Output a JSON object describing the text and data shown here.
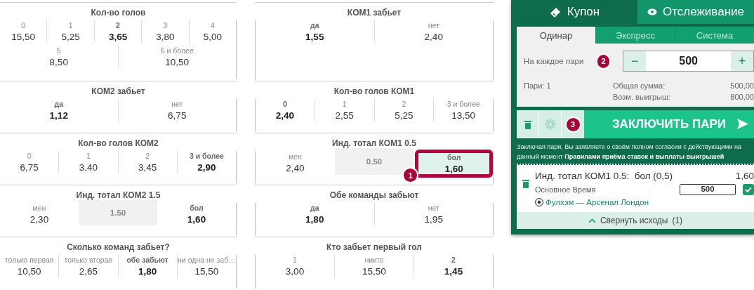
{
  "columns": [
    {
      "markets": [
        {
          "title": "Кол-во голов",
          "lines": [
            {
              "outcomes": [
                {
                  "kind": "odd",
                  "label": "0",
                  "odd": "15,50",
                  "bold": false,
                  "selected": false
                },
                {
                  "kind": "odd",
                  "label": "1",
                  "odd": "5,25",
                  "bold": false,
                  "selected": false
                },
                {
                  "kind": "odd",
                  "label": "2",
                  "odd": "3,65",
                  "bold": true,
                  "selected": false
                },
                {
                  "kind": "odd",
                  "label": "3",
                  "odd": "3,80",
                  "bold": false,
                  "selected": false
                },
                {
                  "kind": "odd",
                  "label": "4",
                  "odd": "5,00",
                  "bold": false,
                  "selected": false
                }
              ]
            },
            {
              "outcomes": [
                {
                  "kind": "odd",
                  "label": "5",
                  "odd": "8,50",
                  "bold": false,
                  "selected": false
                },
                {
                  "kind": "odd",
                  "label": "6 и более",
                  "odd": "10,50",
                  "bold": false,
                  "selected": false
                }
              ]
            }
          ]
        },
        {
          "title": "КОМ2 забьет",
          "lines": [
            {
              "outcomes": [
                {
                  "kind": "odd",
                  "label": "да",
                  "odd": "1,12",
                  "bold": true,
                  "selected": false
                },
                {
                  "kind": "odd",
                  "label": "нет",
                  "odd": "6,75",
                  "bold": false,
                  "selected": false
                }
              ]
            }
          ]
        },
        {
          "title": "Кол-во голов КОМ2",
          "lines": [
            {
              "outcomes": [
                {
                  "kind": "odd",
                  "label": "0",
                  "odd": "6,75",
                  "bold": false,
                  "selected": false
                },
                {
                  "kind": "odd",
                  "label": "1",
                  "odd": "3,40",
                  "bold": false,
                  "selected": false
                },
                {
                  "kind": "odd",
                  "label": "2",
                  "odd": "3,45",
                  "bold": false,
                  "selected": false
                },
                {
                  "kind": "odd",
                  "label": "3 и более",
                  "odd": "2,90",
                  "bold": true,
                  "selected": false
                }
              ]
            }
          ]
        },
        {
          "title": "Инд. тотал КОМ2 1.5",
          "lines": [
            {
              "outcomes": [
                {
                  "kind": "odd",
                  "label": "мен",
                  "odd": "2,30",
                  "bold": false,
                  "selected": false
                },
                {
                  "kind": "line",
                  "value": "1.50"
                },
                {
                  "kind": "odd",
                  "label": "бол",
                  "odd": "1,60",
                  "bold": true,
                  "selected": false
                }
              ]
            }
          ]
        },
        {
          "title": "Сколько команд забьет?",
          "lines": [
            {
              "outcomes": [
                {
                  "kind": "odd",
                  "label": "только первая",
                  "odd": "10,50",
                  "bold": false,
                  "selected": false
                },
                {
                  "kind": "odd",
                  "label": "только вторая",
                  "odd": "2,65",
                  "bold": false,
                  "selected": false
                },
                {
                  "kind": "odd",
                  "label": "обе забьют",
                  "odd": "1,80",
                  "bold": true,
                  "selected": false
                },
                {
                  "kind": "odd",
                  "label": "ни одна не заб…",
                  "odd": "15,50",
                  "bold": false,
                  "selected": false
                }
              ]
            }
          ]
        }
      ]
    },
    {
      "markets": [
        {
          "title": "КОМ1 забьет",
          "lines": [
            {
              "outcomes": [
                {
                  "kind": "odd",
                  "label": "да",
                  "odd": "1,55",
                  "bold": true,
                  "selected": false
                },
                {
                  "kind": "odd",
                  "label": "нет",
                  "odd": "2,40",
                  "bold": false,
                  "selected": false
                }
              ]
            }
          ]
        },
        {
          "title": "Кол-во голов КОМ1",
          "lines": [
            {
              "outcomes": [
                {
                  "kind": "odd",
                  "label": "0",
                  "odd": "2,40",
                  "bold": true,
                  "selected": false
                },
                {
                  "kind": "odd",
                  "label": "1",
                  "odd": "2,55",
                  "bold": false,
                  "selected": false
                },
                {
                  "kind": "odd",
                  "label": "2",
                  "odd": "5,25",
                  "bold": false,
                  "selected": false
                },
                {
                  "kind": "odd",
                  "label": "3 и более",
                  "odd": "13,50",
                  "bold": false,
                  "selected": false
                }
              ]
            }
          ]
        },
        {
          "title": "Инд. тотал КОМ1 0.5",
          "lines": [
            {
              "outcomes": [
                {
                  "kind": "odd",
                  "label": "мен",
                  "odd": "2,40",
                  "bold": false,
                  "selected": false
                },
                {
                  "kind": "line",
                  "value": "0.50"
                },
                {
                  "kind": "odd",
                  "label": "бол",
                  "odd": "1,60",
                  "bold": true,
                  "selected": true,
                  "callout": "1"
                }
              ]
            }
          ]
        },
        {
          "title": "Обе команды забьют",
          "lines": [
            {
              "outcomes": [
                {
                  "kind": "odd",
                  "label": "да",
                  "odd": "1,80",
                  "bold": true,
                  "selected": false
                },
                {
                  "kind": "odd",
                  "label": "нет",
                  "odd": "1,95",
                  "bold": false,
                  "selected": false
                }
              ]
            }
          ]
        },
        {
          "title": "Кто забьет первый гол",
          "lines": [
            {
              "outcomes": [
                {
                  "kind": "odd",
                  "label": "1",
                  "odd": "3,00",
                  "bold": false,
                  "selected": false
                },
                {
                  "kind": "odd",
                  "label": "никто",
                  "odd": "15,50",
                  "bold": false,
                  "selected": false
                },
                {
                  "kind": "odd",
                  "label": "2",
                  "odd": "1,45",
                  "bold": true,
                  "selected": false
                }
              ]
            }
          ]
        }
      ]
    }
  ],
  "coupon": {
    "tabs": [
      {
        "kind": "coupon",
        "label": "Купон",
        "selected": true
      },
      {
        "kind": "tracking",
        "label": "Отслеживание",
        "selected": false
      }
    ],
    "bet_types": [
      {
        "label": "Одинар",
        "selected": true
      },
      {
        "label": "Экспресс",
        "selected": false
      },
      {
        "label": "Система",
        "selected": false
      }
    ],
    "stake": {
      "label": "На каждое пари",
      "decrement": "−",
      "value": "500",
      "increment": "+",
      "callout": "2"
    },
    "summary": {
      "count": "Пари: 1",
      "total_label": "Общая сумма:",
      "total": "500,00",
      "win_label": "Возм. выигрыш:",
      "win": "800,00"
    },
    "actions": {
      "settings_disabled": true,
      "callout": "3",
      "place_button": "ЗАКЛЮЧИТЬ ПАРИ"
    },
    "disclaimer": "Заключая пари, Вы заявляете о своём полном согласии с действующими на данный момент **Правилами приёма ставок и выплаты выигрышей**",
    "bets": [
      {
        "selection": "Инд. тотал КОМ1 0.5:  бол (0,5)",
        "odd": "1,60",
        "period": "Основное Время",
        "stake": "500",
        "checked": true,
        "match": "Фулхэм — Арсенал Лондон"
      }
    ],
    "collapse": {
      "label": "Свернуть исходы",
      "count": "(1)"
    }
  }
}
